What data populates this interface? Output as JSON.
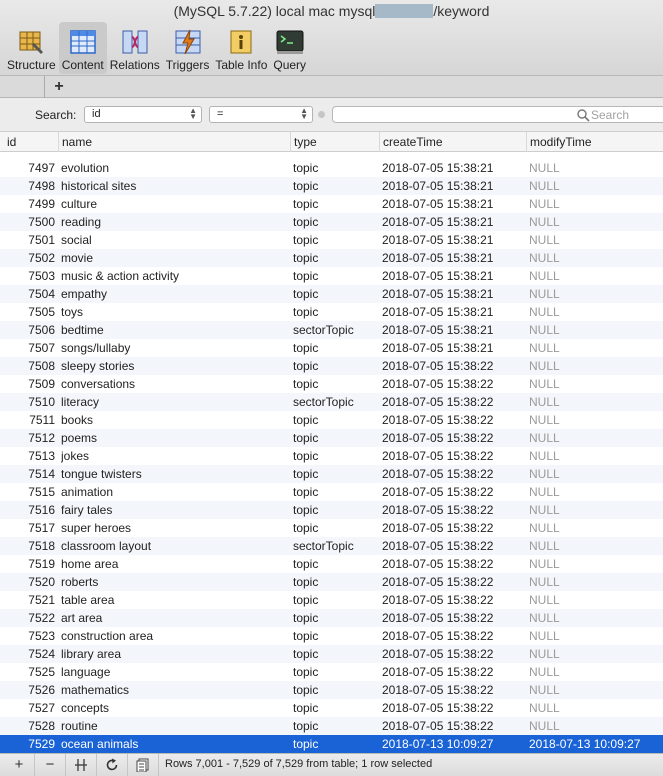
{
  "window": {
    "title_prefix": "(MySQL 5.7.22) local mac mysql",
    "title_suffix": "/keyword"
  },
  "toolbar": {
    "items": [
      {
        "label": "Structure",
        "icon": "structure-icon",
        "active": false
      },
      {
        "label": "Content",
        "icon": "content-icon",
        "active": true
      },
      {
        "label": "Relations",
        "icon": "relations-icon",
        "active": false
      },
      {
        "label": "Triggers",
        "icon": "triggers-icon",
        "active": false
      },
      {
        "label": "Table Info",
        "icon": "table-info-icon",
        "active": false
      },
      {
        "label": "Query",
        "icon": "query-icon",
        "active": false
      }
    ]
  },
  "tabs": {
    "add_label": "+"
  },
  "filter": {
    "label": "Search:",
    "field_value": "id",
    "operator_value": "=",
    "search_placeholder": "Search"
  },
  "table": {
    "columns": [
      "id",
      "name",
      "type",
      "createTime",
      "modifyTime"
    ],
    "rows": [
      {
        "id": "7497",
        "name": "evolution",
        "type": "topic",
        "createTime": "2018-07-05 15:38:21",
        "modifyTime": "NULL"
      },
      {
        "id": "7498",
        "name": "historical sites",
        "type": "topic",
        "createTime": "2018-07-05 15:38:21",
        "modifyTime": "NULL"
      },
      {
        "id": "7499",
        "name": "culture",
        "type": "topic",
        "createTime": "2018-07-05 15:38:21",
        "modifyTime": "NULL"
      },
      {
        "id": "7500",
        "name": "reading",
        "type": "topic",
        "createTime": "2018-07-05 15:38:21",
        "modifyTime": "NULL"
      },
      {
        "id": "7501",
        "name": "social",
        "type": "topic",
        "createTime": "2018-07-05 15:38:21",
        "modifyTime": "NULL"
      },
      {
        "id": "7502",
        "name": "movie",
        "type": "topic",
        "createTime": "2018-07-05 15:38:21",
        "modifyTime": "NULL"
      },
      {
        "id": "7503",
        "name": "music & action activity",
        "type": "topic",
        "createTime": "2018-07-05 15:38:21",
        "modifyTime": "NULL"
      },
      {
        "id": "7504",
        "name": "empathy",
        "type": "topic",
        "createTime": "2018-07-05 15:38:21",
        "modifyTime": "NULL"
      },
      {
        "id": "7505",
        "name": "toys",
        "type": "topic",
        "createTime": "2018-07-05 15:38:21",
        "modifyTime": "NULL"
      },
      {
        "id": "7506",
        "name": "bedtime",
        "type": "sectorTopic",
        "createTime": "2018-07-05 15:38:21",
        "modifyTime": "NULL"
      },
      {
        "id": "7507",
        "name": "songs/lullaby",
        "type": "topic",
        "createTime": "2018-07-05 15:38:21",
        "modifyTime": "NULL"
      },
      {
        "id": "7508",
        "name": "sleepy stories",
        "type": "topic",
        "createTime": "2018-07-05 15:38:22",
        "modifyTime": "NULL"
      },
      {
        "id": "7509",
        "name": "conversations",
        "type": "topic",
        "createTime": "2018-07-05 15:38:22",
        "modifyTime": "NULL"
      },
      {
        "id": "7510",
        "name": "literacy",
        "type": "sectorTopic",
        "createTime": "2018-07-05 15:38:22",
        "modifyTime": "NULL"
      },
      {
        "id": "7511",
        "name": "books",
        "type": "topic",
        "createTime": "2018-07-05 15:38:22",
        "modifyTime": "NULL"
      },
      {
        "id": "7512",
        "name": "poems",
        "type": "topic",
        "createTime": "2018-07-05 15:38:22",
        "modifyTime": "NULL"
      },
      {
        "id": "7513",
        "name": "jokes",
        "type": "topic",
        "createTime": "2018-07-05 15:38:22",
        "modifyTime": "NULL"
      },
      {
        "id": "7514",
        "name": "tongue twisters",
        "type": "topic",
        "createTime": "2018-07-05 15:38:22",
        "modifyTime": "NULL"
      },
      {
        "id": "7515",
        "name": "animation",
        "type": "topic",
        "createTime": "2018-07-05 15:38:22",
        "modifyTime": "NULL"
      },
      {
        "id": "7516",
        "name": "fairy tales",
        "type": "topic",
        "createTime": "2018-07-05 15:38:22",
        "modifyTime": "NULL"
      },
      {
        "id": "7517",
        "name": "super heroes",
        "type": "topic",
        "createTime": "2018-07-05 15:38:22",
        "modifyTime": "NULL"
      },
      {
        "id": "7518",
        "name": "classroom layout",
        "type": "sectorTopic",
        "createTime": "2018-07-05 15:38:22",
        "modifyTime": "NULL"
      },
      {
        "id": "7519",
        "name": "home area",
        "type": "topic",
        "createTime": "2018-07-05 15:38:22",
        "modifyTime": "NULL"
      },
      {
        "id": "7520",
        "name": "roberts",
        "type": "topic",
        "createTime": "2018-07-05 15:38:22",
        "modifyTime": "NULL"
      },
      {
        "id": "7521",
        "name": "table area",
        "type": "topic",
        "createTime": "2018-07-05 15:38:22",
        "modifyTime": "NULL"
      },
      {
        "id": "7522",
        "name": "art area",
        "type": "topic",
        "createTime": "2018-07-05 15:38:22",
        "modifyTime": "NULL"
      },
      {
        "id": "7523",
        "name": "construction area",
        "type": "topic",
        "createTime": "2018-07-05 15:38:22",
        "modifyTime": "NULL"
      },
      {
        "id": "7524",
        "name": "library area",
        "type": "topic",
        "createTime": "2018-07-05 15:38:22",
        "modifyTime": "NULL"
      },
      {
        "id": "7525",
        "name": "language",
        "type": "topic",
        "createTime": "2018-07-05 15:38:22",
        "modifyTime": "NULL"
      },
      {
        "id": "7526",
        "name": "mathematics",
        "type": "topic",
        "createTime": "2018-07-05 15:38:22",
        "modifyTime": "NULL"
      },
      {
        "id": "7527",
        "name": "concepts",
        "type": "topic",
        "createTime": "2018-07-05 15:38:22",
        "modifyTime": "NULL"
      },
      {
        "id": "7528",
        "name": "routine",
        "type": "topic",
        "createTime": "2018-07-05 15:38:22",
        "modifyTime": "NULL"
      },
      {
        "id": "7529",
        "name": "ocean animals",
        "type": "topic",
        "createTime": "2018-07-13 10:09:27",
        "modifyTime": "2018-07-13 10:09:27",
        "selected": true
      }
    ]
  },
  "footer": {
    "add_label": "+",
    "remove_label": "−",
    "status": "Rows 7,001 - 7,529 of 7,529 from table; 1 row selected"
  },
  "colors": {
    "selection": "#1a63d6",
    "null_text": "#9a9a9a"
  }
}
